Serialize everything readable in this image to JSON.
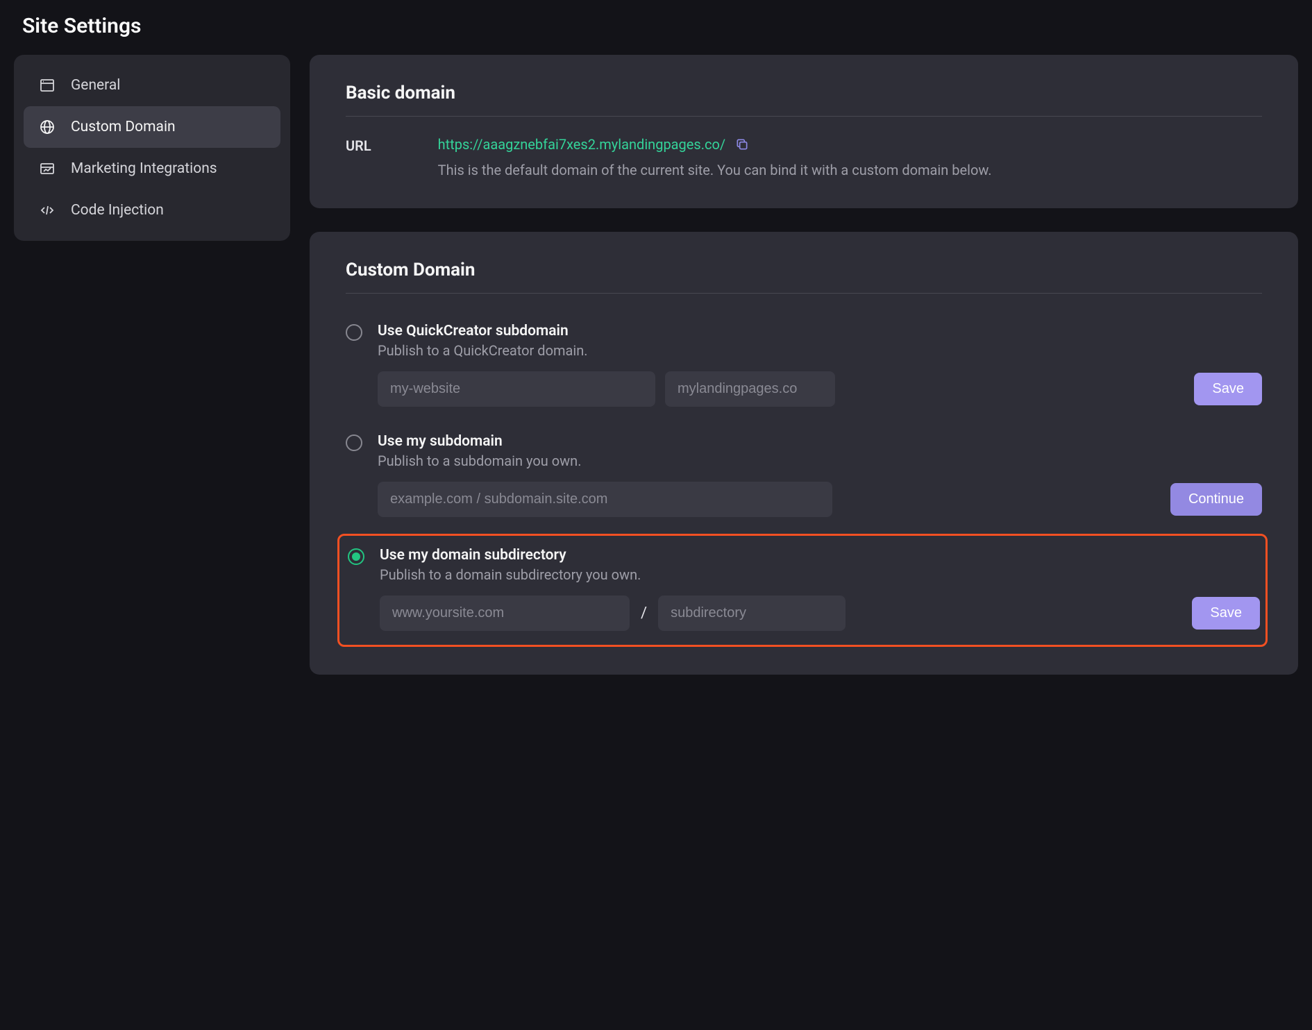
{
  "page_title": "Site Settings",
  "sidebar": {
    "items": [
      {
        "label": "General",
        "icon": "browser-icon",
        "active": false
      },
      {
        "label": "Custom Domain",
        "icon": "globe-icon",
        "active": true
      },
      {
        "label": "Marketing Integrations",
        "icon": "integrate-icon",
        "active": false
      },
      {
        "label": "Code Injection",
        "icon": "code-icon",
        "active": false
      }
    ]
  },
  "basic_domain": {
    "title": "Basic domain",
    "label": "URL",
    "url": "https://aaagznebfai7xes2.mylandingpages.co/",
    "desc": "This is the default domain of the current site. You can bind it with a custom domain below."
  },
  "custom_domain": {
    "title": "Custom Domain",
    "options": [
      {
        "title": "Use QuickCreator subdomain",
        "desc": "Publish to a QuickCreator domain.",
        "selected": false,
        "input1_placeholder": "my-website",
        "input2_placeholder": "mylandingpages.co",
        "button": "Save"
      },
      {
        "title": "Use my subdomain",
        "desc": "Publish to a subdomain you own.",
        "selected": false,
        "input_placeholder": "example.com / subdomain.site.com",
        "button": "Continue"
      },
      {
        "title": "Use my domain subdirectory",
        "desc": "Publish to a domain subdirectory you own.",
        "selected": true,
        "input1_placeholder": "www.yoursite.com",
        "input2_placeholder": "subdirectory",
        "button": "Save"
      }
    ]
  }
}
